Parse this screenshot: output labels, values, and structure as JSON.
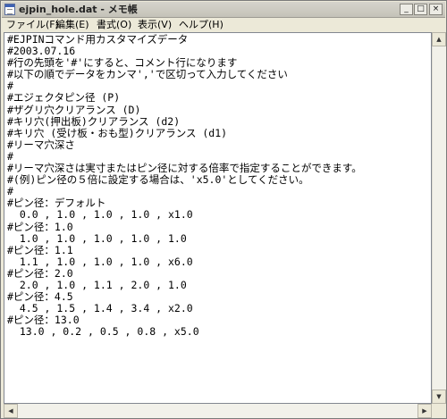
{
  "window": {
    "title": "ejpin_hole.dat - メモ帳",
    "controls": {
      "minimize": "_",
      "maximize": "□",
      "close": "×"
    }
  },
  "menu": [
    "ファイル(F)",
    "編集(E)",
    "書式(O)",
    "表示(V)",
    "ヘルプ(H)"
  ],
  "document": {
    "lines": [
      "#EJPINコマンド用カスタマイズデータ",
      "#2003.07.16",
      "#行の先頭を'#'にすると、コメント行になります",
      "#以下の順でデータをカンマ','で区切って入力してください",
      "#",
      "#エジェクタピン径 (P)",
      "#ザグリ穴クリアランス (D)",
      "#キリ穴(押出板)クリアランス (d2)",
      "#キリ穴 (受け板・おも型)クリアランス (d1)",
      "#リーマ穴深さ",
      "#",
      "#リーマ穴深さは実寸またはピン径に対する倍率で指定することができます。",
      "#(例)ピン径の５倍に設定する場合は、'x5.0'としてください。",
      "#",
      "#ピン径：デフォルト",
      "  0.0 , 1.0 , 1.0 , 1.0 , x1.0",
      "#ピン径：1.0",
      "  1.0 , 1.0 , 1.0 , 1.0 , 1.0",
      "#ピン径：1.1",
      "  1.1 , 1.0 , 1.0 , 1.0 , x6.0",
      "#ピン径：2.0",
      "  2.0 , 1.0 , 1.1 , 2.0 , 1.0",
      "#ピン径：4.5",
      "  4.5 , 1.5 , 1.4 , 3.4 , x2.0",
      "#ピン径：13.0",
      "  13.0 , 0.2 , 0.5 , 0.8 , x5.0"
    ]
  },
  "scrollbar": {
    "up": "▲",
    "down": "▼",
    "left": "◀",
    "right": "▶"
  }
}
